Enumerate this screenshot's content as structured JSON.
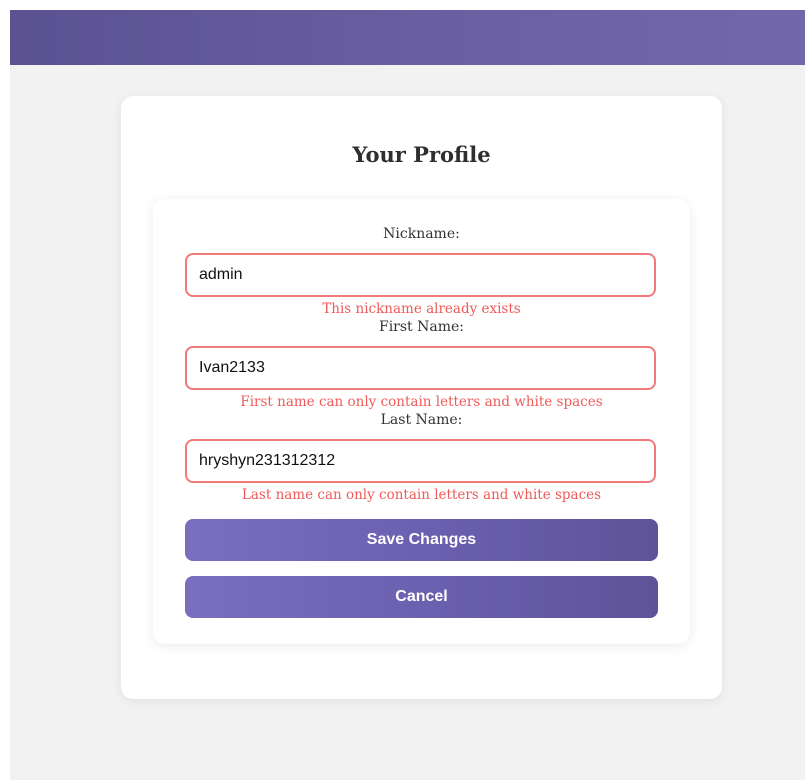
{
  "profile": {
    "title": "Your Profile",
    "nickname": {
      "label": "Nickname:",
      "value": "admin",
      "error": "This nickname already exists"
    },
    "first_name": {
      "label": "First Name:",
      "value": "Ivan2133",
      "error": "First name can only contain letters and white spaces"
    },
    "last_name": {
      "label": "Last Name:",
      "value": "hryshyn231312312",
      "error": "Last name can only contain letters and white spaces"
    },
    "save_label": "Save Changes",
    "cancel_label": "Cancel"
  },
  "colors": {
    "header_gradient_start": "#5b5292",
    "header_gradient_end": "#7367ab",
    "error": "#ef5a5a",
    "input_error_border": "#f07a7a",
    "button_gradient_start": "#7a6fbf",
    "button_gradient_end": "#5e5399"
  }
}
